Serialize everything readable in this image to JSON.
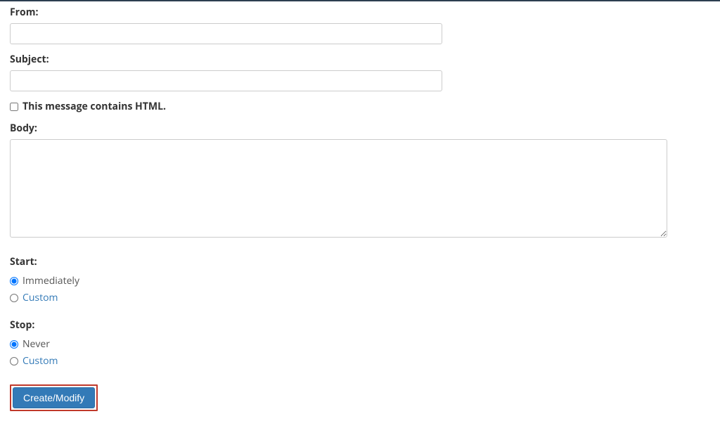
{
  "from": {
    "label": "From:",
    "value": ""
  },
  "subject": {
    "label": "Subject:",
    "value": ""
  },
  "html_checkbox": {
    "label": "This message contains HTML.",
    "checked": false
  },
  "body": {
    "label": "Body:",
    "value": ""
  },
  "start": {
    "label": "Start:",
    "options": {
      "immediately": "Immediately",
      "custom": "Custom"
    },
    "selected": "immediately"
  },
  "stop": {
    "label": "Stop:",
    "options": {
      "never": "Never",
      "custom": "Custom"
    },
    "selected": "never"
  },
  "submit": {
    "label": "Create/Modify"
  }
}
